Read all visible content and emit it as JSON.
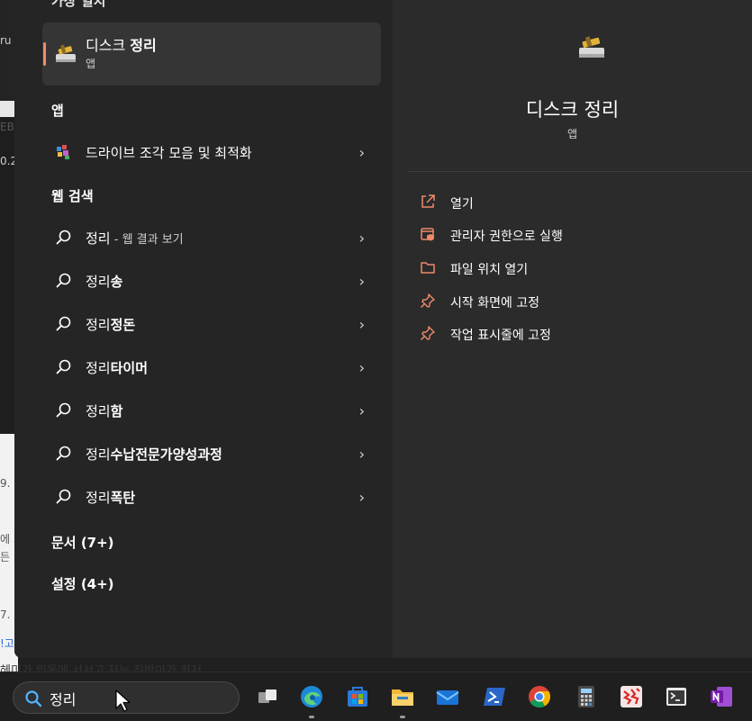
{
  "background": {
    "fragments": [
      "ru",
      "EB",
      "0.2",
      "9.",
      "에 기",
      "든",
      "7.",
      "!고"
    ],
    "bottom_text": "헤미가 입동에 서서고 저는 진박이가 최저"
  },
  "left": {
    "top_section_partial": "가장 일치",
    "best_match": {
      "title_pre": "디스크 ",
      "title_bold": "정리",
      "subtitle": "앱"
    },
    "apps_title": "앱",
    "apps": [
      {
        "label": "드라이브 조각 모음 및 최적화"
      }
    ],
    "web_title": "웹 검색",
    "web_results": [
      {
        "prefix": "정리",
        "bold": "",
        "hint": " - 웹 결과 보기"
      },
      {
        "prefix": "정리",
        "bold": "송",
        "hint": ""
      },
      {
        "prefix": "정리",
        "bold": "정돈",
        "hint": ""
      },
      {
        "prefix": "정리",
        "bold": "타이머",
        "hint": ""
      },
      {
        "prefix": "정리",
        "bold": "함",
        "hint": ""
      },
      {
        "prefix": "정리",
        "bold": "수납전문가양성과정",
        "hint": ""
      },
      {
        "prefix": "정리",
        "bold": "폭탄",
        "hint": ""
      }
    ],
    "docs_title": "문서 (7+)",
    "settings_title": "설정 (4+)"
  },
  "right": {
    "title": "디스크 정리",
    "subtitle": "앱",
    "actions": [
      {
        "label": "열기",
        "icon": "open-external-icon"
      },
      {
        "label": "관리자 권한으로 실행",
        "icon": "run-as-admin-icon"
      },
      {
        "label": "파일 위치 열기",
        "icon": "folder-icon"
      },
      {
        "label": "시작 화면에 고정",
        "icon": "pin-icon"
      },
      {
        "label": "작업 표시줄에 고정",
        "icon": "pin-icon"
      }
    ]
  },
  "taskbar": {
    "search_value": "정리",
    "apps": [
      "task-view",
      "edge",
      "microsoft-store",
      "file-explorer",
      "mail",
      "powershell",
      "chrome",
      "calculator",
      "app-red-icon",
      "terminal",
      "onenote"
    ]
  },
  "colors": {
    "accent": "#f08a6a",
    "panel": "#272727",
    "taskbar": "#1f1f1f"
  }
}
